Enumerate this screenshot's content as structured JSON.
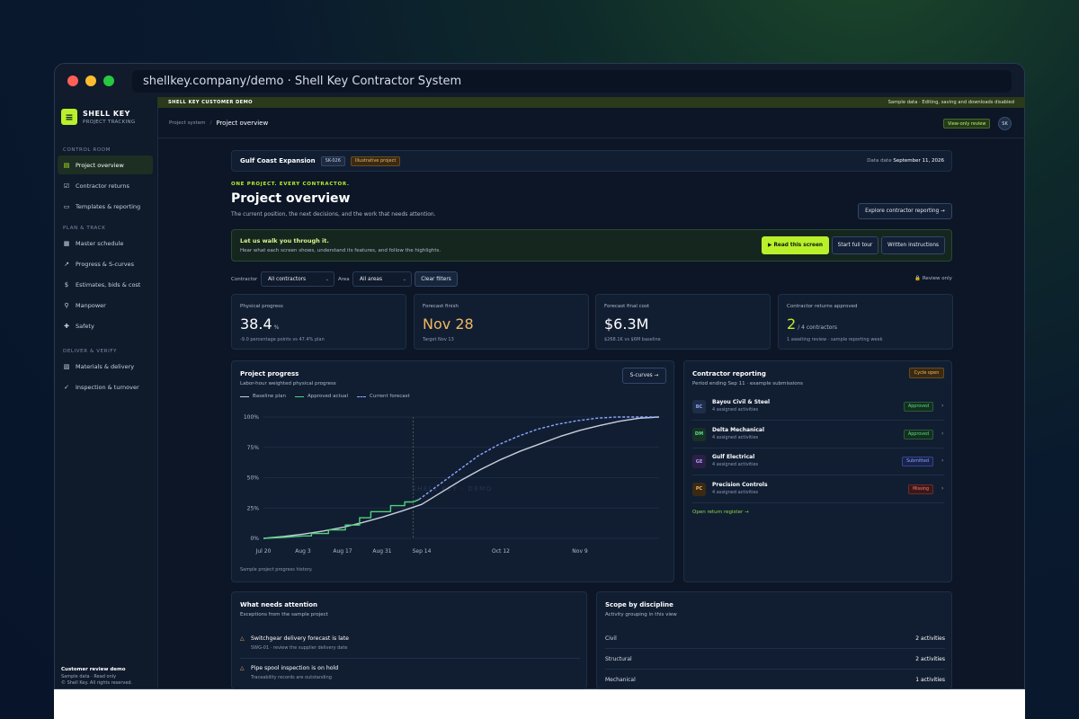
{
  "browser": {
    "url": "shellkey.company/demo · Shell Key Contractor System"
  },
  "brand": {
    "logo_glyph": "≡",
    "name": "SHELL KEY",
    "tagline": "PROJECT TRACKING"
  },
  "sidebar": {
    "sections": [
      {
        "label": "CONTROL ROOM",
        "items": [
          {
            "label": "Project overview",
            "icon": "▤",
            "active": true
          },
          {
            "label": "Contractor returns",
            "icon": "☑"
          },
          {
            "label": "Templates & reporting",
            "icon": "▭"
          }
        ]
      },
      {
        "label": "PLAN & TRACK",
        "items": [
          {
            "label": "Master schedule",
            "icon": "▦"
          },
          {
            "label": "Progress & S-curves",
            "icon": "↗"
          },
          {
            "label": "Estimates, bids & cost",
            "icon": "$"
          },
          {
            "label": "Manpower",
            "icon": "⚲"
          },
          {
            "label": "Safety",
            "icon": "✚"
          }
        ]
      },
      {
        "label": "DELIVER & VERIFY",
        "items": [
          {
            "label": "Materials & delivery",
            "icon": "▧"
          },
          {
            "label": "Inspection & turnover",
            "icon": "✓"
          }
        ]
      }
    ],
    "footer": {
      "title": "Customer review demo",
      "line1": "Sample data · Read only",
      "line2": "© Shell Key. All rights reserved."
    }
  },
  "banner": {
    "left": "SHELL KEY CUSTOMER DEMO",
    "right": "Sample data · Editing, saving and downloads disabled"
  },
  "breadcrumb": {
    "parent": "Project system",
    "sep": "/",
    "current": "Project overview"
  },
  "header": {
    "view_badge": "View-only review",
    "avatar": "SK"
  },
  "project": {
    "name": "Gulf Coast Expansion",
    "code": "SK-026",
    "tag": "Illustrative project",
    "date_label": "Data date",
    "date": "September 11, 2026"
  },
  "hero": {
    "kicker": "ONE PROJECT. EVERY CONTRACTOR.",
    "title": "Project overview",
    "subtitle": "The current position, the next decisions, and the work that needs attention.",
    "explore_button": "Explore contractor reporting →"
  },
  "walkthrough": {
    "title": "Let us walk you through it.",
    "desc": "Hear what each screen shows, understand its features, and follow the highlights.",
    "btn_read": "▶ Read this screen",
    "btn_tour": "Start full tour",
    "btn_written": "Written instructions"
  },
  "filters": {
    "contractor_label": "Contractor",
    "contractor_value": "All contractors",
    "area_label": "Area",
    "area_value": "All areas",
    "chevron": "⌄",
    "clear": "Clear filters",
    "lock_icon": "🔒",
    "review_only": "Review only"
  },
  "kpis": [
    {
      "label": "Physical progress",
      "value": "38.4",
      "unit": "%",
      "note": "-9.0 percentage points vs 47.4% plan",
      "color": "#ffffff"
    },
    {
      "label": "Forecast finish",
      "value": "Nov 28",
      "unit": "",
      "note": "Target Nov 13",
      "color": "#f0b860"
    },
    {
      "label": "Forecast final cost",
      "value": "$6.3M",
      "unit": "",
      "note": "$268.1K vs $6M baseline",
      "color": "#ffffff"
    },
    {
      "label": "Contractor returns approved",
      "value": "2",
      "unit": "/ 4 contractors",
      "note": "1 awaiting review · sample reporting week",
      "color": "#b8f02a"
    }
  ],
  "progress_panel": {
    "title": "Project progress",
    "subtitle": "Labor-hour weighted physical progress",
    "scurves_button": "S-curves →",
    "source": "Sample project progress history.",
    "watermark": "SHELL KEY · DEMO"
  },
  "chart_data": {
    "type": "line",
    "title": "Project progress",
    "ylim": [
      0,
      100
    ],
    "yticks": [
      "0%",
      "25%",
      "50%",
      "75%",
      "100%"
    ],
    "xticks": [
      "Jul 20",
      "Aug 3",
      "Aug 17",
      "Aug 31",
      "Sep 14",
      "Oct 12",
      "Nov 9"
    ],
    "data_date": "Sep 11",
    "series": [
      {
        "name": "Baseline plan",
        "color": "#c9cfdc",
        "style": "solid",
        "points": [
          [
            "2026-07-20",
            0
          ],
          [
            "2026-07-27",
            1.5
          ],
          [
            "2026-08-03",
            3.5
          ],
          [
            "2026-08-10",
            6
          ],
          [
            "2026-08-17",
            9
          ],
          [
            "2026-08-24",
            13
          ],
          [
            "2026-08-31",
            17.5
          ],
          [
            "2026-09-07",
            22.5
          ],
          [
            "2026-09-14",
            28
          ],
          [
            "2026-09-21",
            38
          ],
          [
            "2026-09-28",
            48
          ],
          [
            "2026-10-05",
            57
          ],
          [
            "2026-10-12",
            65
          ],
          [
            "2026-10-19",
            72
          ],
          [
            "2026-10-26",
            78
          ],
          [
            "2026-11-02",
            84
          ],
          [
            "2026-11-09",
            89
          ],
          [
            "2026-11-16",
            93
          ],
          [
            "2026-11-23",
            96.5
          ],
          [
            "2026-11-30",
            99
          ],
          [
            "2026-12-07",
            100
          ]
        ]
      },
      {
        "name": "Approved actual",
        "color": "#4fd37a",
        "style": "step",
        "points": [
          [
            "2026-07-20",
            0
          ],
          [
            "2026-07-27",
            0.8
          ],
          [
            "2026-08-03",
            2
          ],
          [
            "2026-08-06",
            2
          ],
          [
            "2026-08-06",
            4
          ],
          [
            "2026-08-12",
            4
          ],
          [
            "2026-08-12",
            7
          ],
          [
            "2026-08-18",
            7
          ],
          [
            "2026-08-18",
            11
          ],
          [
            "2026-08-23",
            11
          ],
          [
            "2026-08-23",
            17
          ],
          [
            "2026-08-27",
            17
          ],
          [
            "2026-08-27",
            22
          ],
          [
            "2026-09-03",
            22
          ],
          [
            "2026-09-03",
            27
          ],
          [
            "2026-09-08",
            27
          ],
          [
            "2026-09-08",
            30
          ],
          [
            "2026-09-11",
            30
          ],
          [
            "2026-09-13",
            32
          ]
        ]
      },
      {
        "name": "Current forecast",
        "color": "#8ea6ff",
        "style": "dashed",
        "points": [
          [
            "2026-09-13",
            32
          ],
          [
            "2026-09-20",
            44
          ],
          [
            "2026-09-27",
            56
          ],
          [
            "2026-10-04",
            68
          ],
          [
            "2026-10-11",
            77
          ],
          [
            "2026-10-18",
            84
          ],
          [
            "2026-10-25",
            90
          ],
          [
            "2026-11-01",
            94
          ],
          [
            "2026-11-08",
            97
          ],
          [
            "2026-11-15",
            99
          ],
          [
            "2026-11-22",
            100
          ],
          [
            "2026-12-07",
            100
          ]
        ]
      }
    ]
  },
  "contractors_panel": {
    "title": "Contractor reporting",
    "subtitle": "Period ending Sep 11 · example submissions",
    "cycle_badge": "Cycle open",
    "open_register": "Open return register →",
    "rows": [
      {
        "initials": "BC",
        "name": "Bayou Civil & Steel",
        "activities": "4 assigned activities",
        "status": "Approved",
        "av_bg": "#1e2e48",
        "av_fg": "#8ea6ff",
        "st_bg": "#12301e",
        "st_fg": "#5fdc8a",
        "st_bd": "#2a5a3a"
      },
      {
        "initials": "DM",
        "name": "Delta Mechanical",
        "activities": "4 assigned activities",
        "status": "Approved",
        "av_bg": "#163326",
        "av_fg": "#5fdc8a",
        "st_bg": "#12301e",
        "st_fg": "#5fdc8a",
        "st_bd": "#2a5a3a"
      },
      {
        "initials": "GE",
        "name": "Gulf Electrical",
        "activities": "4 assigned activities",
        "status": "Submitted",
        "av_bg": "#2a2046",
        "av_fg": "#b89aff",
        "st_bg": "#18224a",
        "st_fg": "#8ea6ff",
        "st_bd": "#34468a"
      },
      {
        "initials": "PC",
        "name": "Precision Controls",
        "activities": "4 assigned activities",
        "status": "Missing",
        "av_bg": "#3a2a14",
        "av_fg": "#f0b860",
        "st_bg": "#3a1818",
        "st_fg": "#ff7a7a",
        "st_bd": "#6a2a2a"
      }
    ]
  },
  "attention": {
    "title": "What needs attention",
    "subtitle": "Exceptions from the sample project",
    "icon": "△",
    "items": [
      {
        "title": "Switchgear delivery forecast is late",
        "desc": "SWG-01 · review the supplier delivery date"
      },
      {
        "title": "Pipe spool inspection is on hold",
        "desc": "Traceability records are outstanding"
      }
    ]
  },
  "scope": {
    "title": "Scope by discipline",
    "subtitle": "Activity grouping in this view",
    "rows": [
      {
        "name": "Civil",
        "count": "2 activities"
      },
      {
        "name": "Structural",
        "count": "2 activities"
      },
      {
        "name": "Mechanical",
        "count": "1 activities"
      }
    ]
  }
}
